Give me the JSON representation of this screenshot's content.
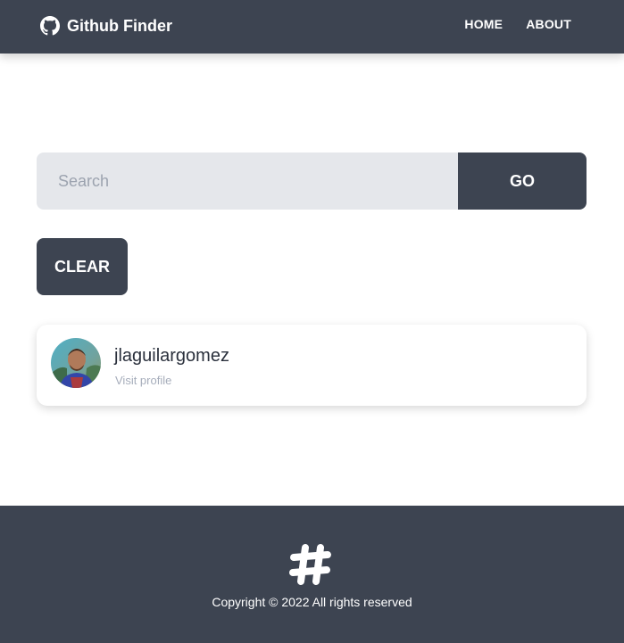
{
  "navbar": {
    "brand_icon": "github-icon",
    "brand_title": "Github Finder",
    "links": [
      "HOME",
      "ABOUT"
    ]
  },
  "search": {
    "placeholder": "Search",
    "value": "",
    "go_label": "GO"
  },
  "clear_label": "CLEAR",
  "users": [
    {
      "login": "jlaguilargomez",
      "link_label": "Visit profile"
    }
  ],
  "footer": {
    "logo_icon": "hashtag-icon",
    "copyright": "Copyright © 2022 All rights reserved"
  },
  "colors": {
    "primary": "#3d4451",
    "input_bg": "#e5e7eb",
    "muted_text": "#a6adbb"
  }
}
